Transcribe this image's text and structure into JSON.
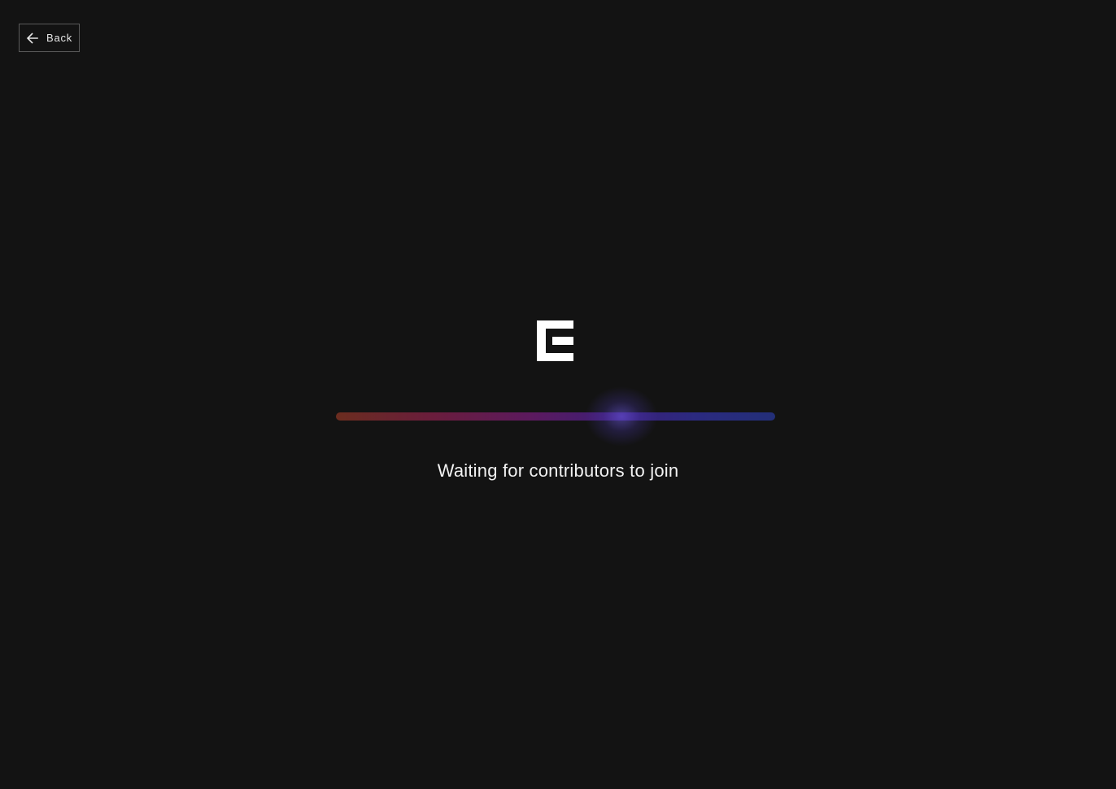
{
  "header": {
    "back_label": "Back",
    "back_icon": "arrow-left-icon"
  },
  "logo": {
    "icon": "brand-logo-icon",
    "color": "#ffffff"
  },
  "loader": {
    "progress": 0.65,
    "colors": [
      "#6b2d1f",
      "#6a1d3c",
      "#5b1a5f",
      "#3a1f78",
      "#232f78"
    ]
  },
  "status": {
    "text": "Waiting for contributors to join"
  },
  "theme": {
    "background": "#131313",
    "text": "#f2f2f2",
    "border": "#5a5a5a"
  }
}
